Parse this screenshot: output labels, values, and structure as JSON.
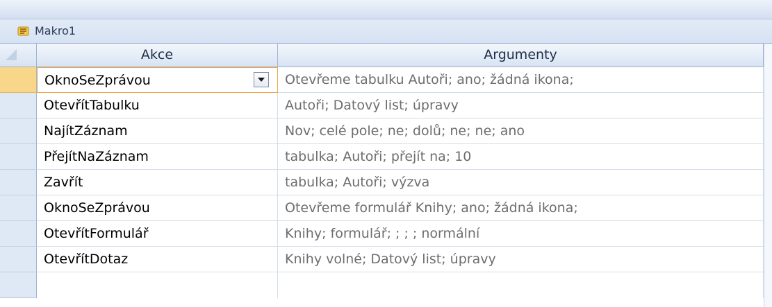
{
  "window": {
    "tab_title": "Makro1",
    "tab_icon": "macro-icon"
  },
  "grid": {
    "columns": [
      "Akce",
      "Argumenty"
    ],
    "rows": [
      {
        "action": "OknoSeZprávou",
        "arguments": "Otevřeme tabulku Autoři; ano; žádná ikona;"
      },
      {
        "action": "OtevřítTabulku",
        "arguments": "Autoři; Datový list; úpravy"
      },
      {
        "action": "NajítZáznam",
        "arguments": "Nov; celé pole; ne; dolů; ne; ne; ano"
      },
      {
        "action": "PřejítNaZáznam",
        "arguments": "tabulka; Autoři; přejít na; 10"
      },
      {
        "action": "Zavřít",
        "arguments": "tabulka; Autoři; výzva"
      },
      {
        "action": "OknoSeZprávou",
        "arguments": "Otevřeme formulář Knihy; ano; žádná ikona;"
      },
      {
        "action": "OtevřítFormulář",
        "arguments": "Knihy; formulář; ; ; ; normální"
      },
      {
        "action": "OtevřítDotaz",
        "arguments": "Knihy volné; Datový list; úpravy"
      },
      {
        "action": "",
        "arguments": ""
      }
    ],
    "current_row": 0
  },
  "colors": {
    "current_row_selector": "#f8d78a",
    "current_cell_border": "#f0a44a",
    "argument_text": "#6d6d6d",
    "header_text": "#1f2f48"
  }
}
